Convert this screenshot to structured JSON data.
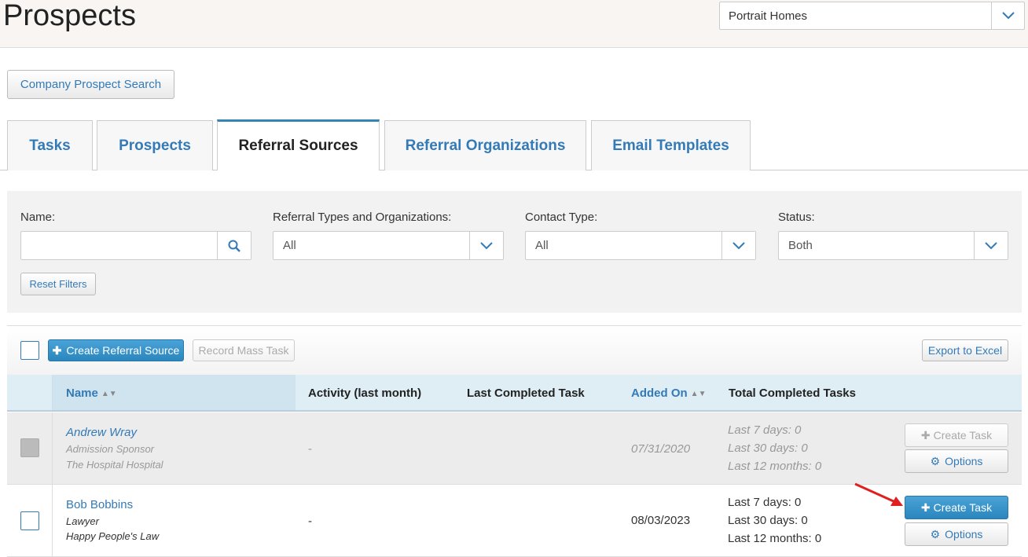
{
  "header": {
    "title": "Prospects",
    "company_select": "Portrait Homes"
  },
  "company_prospect_search_label": "Company Prospect Search",
  "tabs": [
    {
      "label": "Tasks",
      "active": false
    },
    {
      "label": "Prospects",
      "active": false
    },
    {
      "label": "Referral Sources",
      "active": true
    },
    {
      "label": "Referral Organizations",
      "active": false
    },
    {
      "label": "Email Templates",
      "active": false
    }
  ],
  "filters": {
    "name_label": "Name:",
    "name_value": "",
    "types_label": "Referral Types and Organizations:",
    "types_value": "All",
    "contact_label": "Contact Type:",
    "contact_value": "All",
    "status_label": "Status:",
    "status_value": "Both",
    "reset_label": "Reset Filters"
  },
  "toolbar": {
    "create_label": "Create Referral Source",
    "mass_task_label": "Record Mass Task",
    "export_label": "Export to Excel"
  },
  "table": {
    "columns": [
      "Name",
      "Activity (last month)",
      "Last Completed Task",
      "Added On",
      "Total Completed Tasks"
    ],
    "rows": [
      {
        "name": "Andrew Wray",
        "type": "Admission Sponsor",
        "org": "The Hospital Hospital",
        "activity": "-",
        "last_task": "",
        "added_on": "07/31/2020",
        "last7": "Last 7 days: 0",
        "last30": "Last 30 days: 0",
        "last12": "Last 12 months: 0",
        "create_task": "Create Task",
        "options": "Options",
        "inactive": true
      },
      {
        "name": "Bob Bobbins",
        "type": "Lawyer",
        "org": "Happy People's Law",
        "activity": "-",
        "last_task": "",
        "added_on": "08/03/2023",
        "last7": "Last 7 days: 0",
        "last30": "Last 30 days: 0",
        "last12": "Last 12 months: 0",
        "create_task": "Create Task",
        "options": "Options",
        "inactive": false
      }
    ]
  },
  "colors": {
    "link": "#337ab7",
    "primary": "#2a86be",
    "annotation_arrow": "#e02020"
  }
}
